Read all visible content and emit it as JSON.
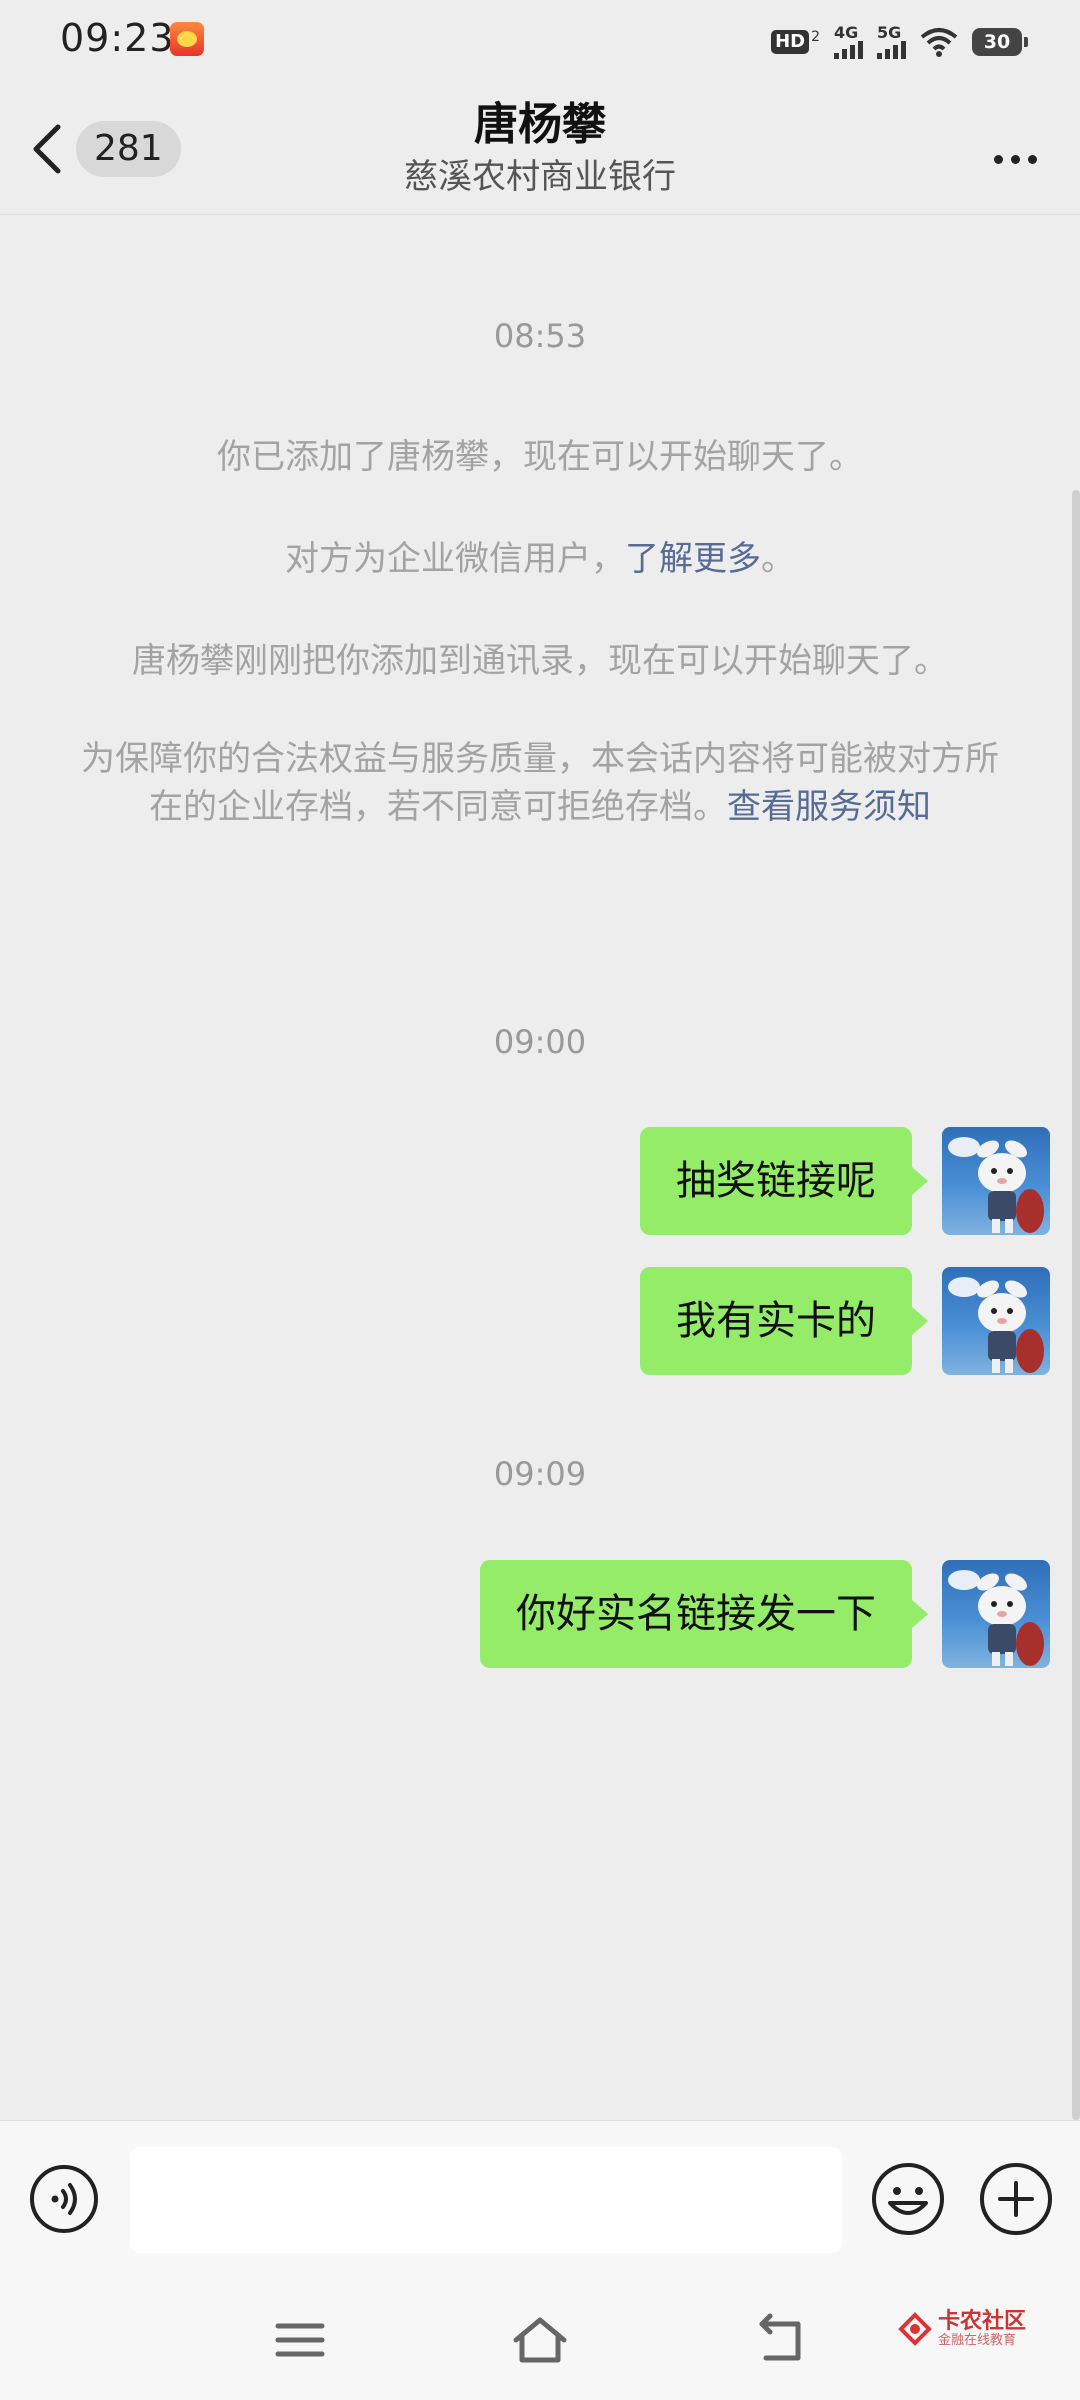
{
  "status_bar": {
    "time": "09:23",
    "hd_label": "HD",
    "hd_sub": "2",
    "net1_label": "4G",
    "net2_label": "5G",
    "battery_level": "30"
  },
  "header": {
    "unread_count": "281",
    "title": "唐杨攀",
    "subtitle": "慈溪农村商业银行"
  },
  "messages": {
    "time_1": "08:53",
    "note_1": "你已添加了唐杨攀，现在可以开始聊天了。",
    "note_2_prefix": "对方为企业微信用户，",
    "note_2_link": "了解更多",
    "note_2_suffix": "。",
    "note_3": "唐杨攀刚刚把你添加到通讯录，现在可以开始聊天了。",
    "note_4_text": "为保障你的合法权益与服务质量，本会话内容将可能被对方所在的企业存档，若不同意可拒绝存档。",
    "note_4_link": "查看服务须知",
    "time_2": "09:00",
    "msg_1": "抽奖链接呢",
    "msg_2": "我有实卡的",
    "time_3": "09:09",
    "msg_3": "你好实名链接发一下"
  },
  "input_bar": {
    "placeholder": "",
    "voice_icon": "voice-icon",
    "emoji_icon": "emoji-icon",
    "plus_icon": "plus-icon"
  },
  "watermark": {
    "title": "卡农社区",
    "sub": "金融在线教育"
  },
  "colors": {
    "bubble": "#95ec69",
    "link": "#576b95",
    "background": "#ededed"
  }
}
